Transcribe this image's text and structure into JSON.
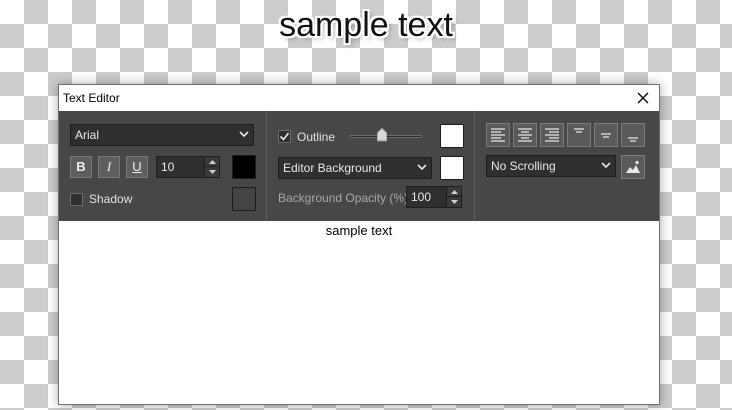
{
  "overlay": {
    "text": "sample text"
  },
  "window": {
    "title": "Text Editor"
  },
  "font": {
    "family": "Arial",
    "size": "10",
    "color": "#000000"
  },
  "format": {
    "bold": "B",
    "italic": "I",
    "underline": "U"
  },
  "shadow": {
    "label": "Shadow",
    "checked": false
  },
  "outline": {
    "label": "Outline",
    "checked": true,
    "color": "#ffffff"
  },
  "background": {
    "mode": "Editor Background",
    "color": "#ffffff",
    "opacity_label": "Background Opacity (%):",
    "opacity": "100"
  },
  "scrolling": {
    "mode": "No Scrolling"
  },
  "alignment": {
    "buttons": [
      "align-left",
      "align-center",
      "align-right",
      "align-top",
      "align-middle",
      "align-bottom"
    ]
  },
  "editor": {
    "content": "sample text"
  }
}
